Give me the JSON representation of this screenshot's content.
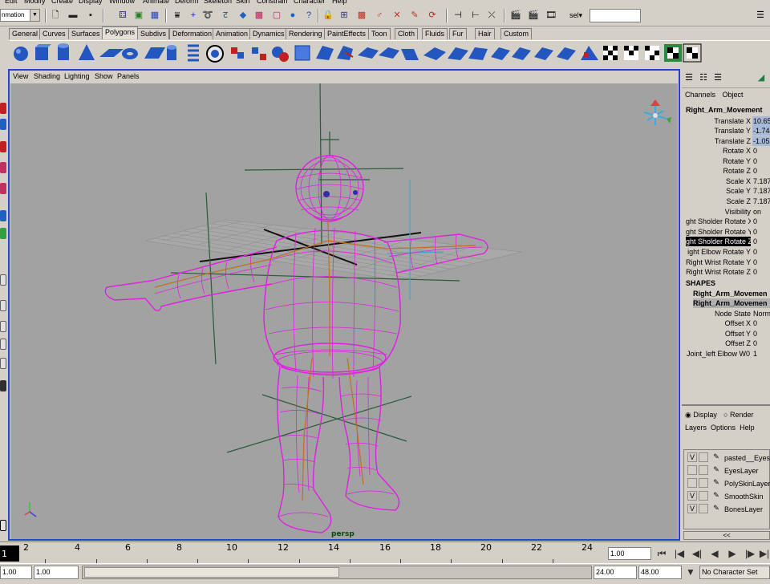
{
  "menubar": {
    "items": [
      "Edit",
      "Modify",
      "Create",
      "Display",
      "Window",
      "Animate",
      "Deform",
      "Skeleton",
      "Skin",
      "Constrain",
      "Character",
      "Help"
    ]
  },
  "status": {
    "mode": "nmation",
    "sel_label": "sel▾",
    "sel_value": ""
  },
  "shelf_tabs": [
    "General",
    "Curves",
    "Surfaces",
    "Polygons",
    "Subdivs",
    "Deformation",
    "Animation",
    "Dynamics",
    "Rendering",
    "PaintEffects",
    "Toon",
    "Cloth",
    "Fluids",
    "Fur",
    "Hair",
    "Custom"
  ],
  "active_shelf_tab": "Polygons",
  "panel_menu": [
    "View",
    "Shading",
    "Lighting",
    "Show",
    "Panels"
  ],
  "viewport": {
    "camera_label": "persp"
  },
  "channel_box": {
    "tabs": [
      "Channels",
      "Object"
    ],
    "node_name": "Right_Arm_Movement",
    "attributes": [
      {
        "label": "Translate X",
        "value": "10.65"
      },
      {
        "label": "Translate Y",
        "value": "-1.744"
      },
      {
        "label": "Translate Z",
        "value": "-1.053"
      },
      {
        "label": "Rotate X",
        "value": "0"
      },
      {
        "label": "Rotate Y",
        "value": "0"
      },
      {
        "label": "Rotate Z",
        "value": "0"
      },
      {
        "label": "Scale X",
        "value": "7.187"
      },
      {
        "label": "Scale Y",
        "value": "7.187"
      },
      {
        "label": "Scale Z",
        "value": "7.187"
      },
      {
        "label": "Visibility",
        "value": "on"
      },
      {
        "label": "ght Sholder Rotate X",
        "value": "0"
      },
      {
        "label": "ght Sholder Rotate Y",
        "value": "0"
      },
      {
        "label": "ght Sholder Rotate Z",
        "value": "0"
      },
      {
        "label": "ight Elbow Rotate Y",
        "value": "0"
      },
      {
        "label": "Right Wrist Rotate Y",
        "value": "0"
      },
      {
        "label": "Right Wrist Rotate Z",
        "value": "0"
      }
    ],
    "shapes_title": "SHAPES",
    "shape_items": [
      "Right_Arm_Movemen",
      "Right_Arm_Movemen"
    ],
    "shape_attributes": [
      {
        "label": "Node State",
        "value": "Norma"
      },
      {
        "label": "Offset X",
        "value": "0"
      },
      {
        "label": "Offset Y",
        "value": "0"
      },
      {
        "label": "Offset Z",
        "value": "0"
      },
      {
        "label": "Joint_left Elbow W0",
        "value": "1"
      }
    ]
  },
  "layer_editor": {
    "radio_display": "Display",
    "radio_render": "Render",
    "menu": [
      "Layers",
      "Options",
      "Help"
    ],
    "layers": [
      {
        "visible": "V",
        "name": "pasted__EyesL"
      },
      {
        "visible": "",
        "name": "EyesLayer"
      },
      {
        "visible": "",
        "name": "PolySkinLayer"
      },
      {
        "visible": "V",
        "name": "SmoothSkin"
      },
      {
        "visible": "V",
        "name": "BonesLayer"
      }
    ],
    "scroll_label": "<<"
  },
  "timeline": {
    "ticks": [
      "2",
      "4",
      "6",
      "8",
      "10",
      "12",
      "14",
      "16",
      "18",
      "20",
      "22",
      "24"
    ],
    "current_frame": "1.00",
    "current_marker": "1"
  },
  "range": {
    "start": "1.00",
    "start_field": "1.00",
    "end_field": "24.00",
    "end": "48.00",
    "character_set": "No Character Set"
  }
}
